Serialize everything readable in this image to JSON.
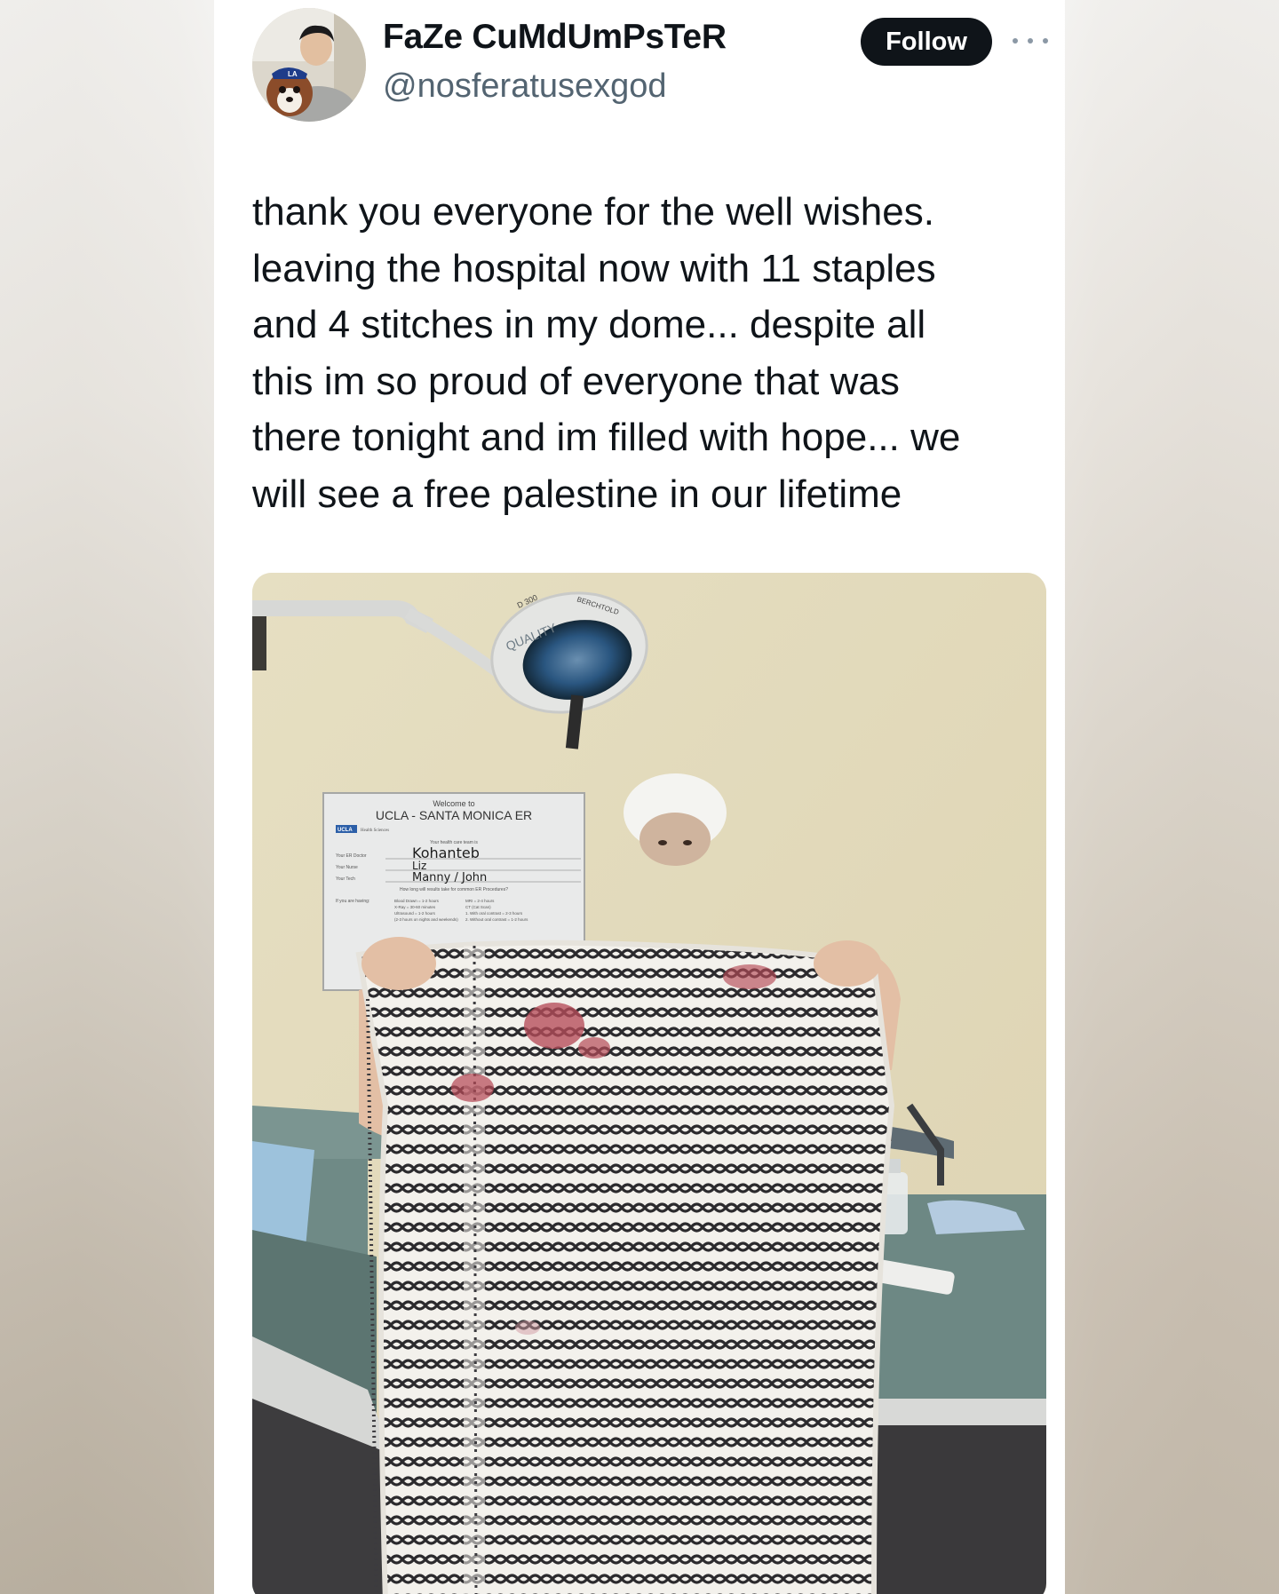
{
  "tweet": {
    "author": {
      "display_name": "FaZe CuMdUmPsTeR",
      "handle": "@nosferatusexgod"
    },
    "follow_label": "Follow",
    "more_icon": "more-horizontal-icon",
    "text": "thank you everyone for the well wishes.\nleaving the hospital now with 11 staples\nand 4 stitches in my dome... despite all\nthis im so proud of everyone that was\nthere tonight and im filled with hope... we\nwill see a free palestine in our lifetime"
  },
  "media": {
    "sign": {
      "welcome": "Welcome to",
      "title": "UCLA - SANTA MONICA ER",
      "logo": "UCLA",
      "logo_sub": "Health Sciences",
      "team_heading": "Your health care team is",
      "doctor_label": "Your ER Doctor",
      "nurse_label": "Your Nurse",
      "tech_label": "Your Tech",
      "doctor_value": "Kohanteb",
      "nurse_value": "Liz",
      "tech_value": "Manny / John",
      "results_heading": "How long will results take for common ER Procedures?",
      "waiting_label": "If you are having:",
      "procedures_left": [
        "Blood Drawn = 1-2 hours",
        "X-Ray = 30-60 minutes",
        "Ultrasound = 1-2 hours",
        "(2-3 hours on nights and weekends)"
      ],
      "procedures_right": [
        "MRI = 2-4 hours",
        "CT (Cat Scan)",
        "1. With oral contrast = 2-3 hours",
        "2. Without oral contrast = 1-2 hours"
      ]
    },
    "lamp_text_left": "D 300",
    "lamp_text_right": "BERCHTOLD",
    "lamp_brand": "QUALITY"
  },
  "colors": {
    "text_primary": "#0f1419",
    "text_secondary": "#536471",
    "follow_bg": "#0f1419",
    "follow_fg": "#ffffff"
  }
}
